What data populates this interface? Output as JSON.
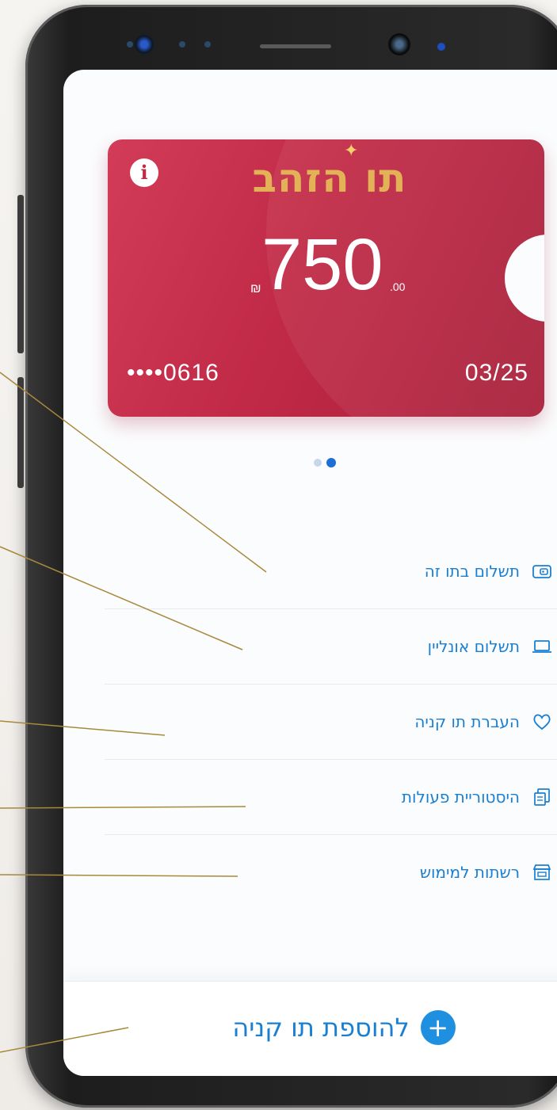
{
  "card": {
    "logo_text": "תו הזהב",
    "currency": "₪",
    "amount_int": "750",
    "amount_dec": ".00",
    "card_number": "••••0616",
    "expiry": "03/25",
    "color": "#c12a46",
    "logo_color": "#e4b256"
  },
  "pagination": {
    "total": 2,
    "active": 2
  },
  "menu": {
    "items": [
      {
        "label": "תשלום בתו זה",
        "icon": "wallet-icon"
      },
      {
        "label": "תשלום אונליין",
        "icon": "laptop-icon"
      },
      {
        "label": "העברת תו קניה",
        "icon": "heart-icon"
      },
      {
        "label": "היסטוריית פעולות",
        "icon": "history-icon"
      },
      {
        "label": "רשתות למימוש",
        "icon": "store-icon"
      }
    ]
  },
  "add_button": {
    "label": "להוספת תו קניה",
    "icon": "plus-icon"
  },
  "accent_color": "#1a7fd1"
}
